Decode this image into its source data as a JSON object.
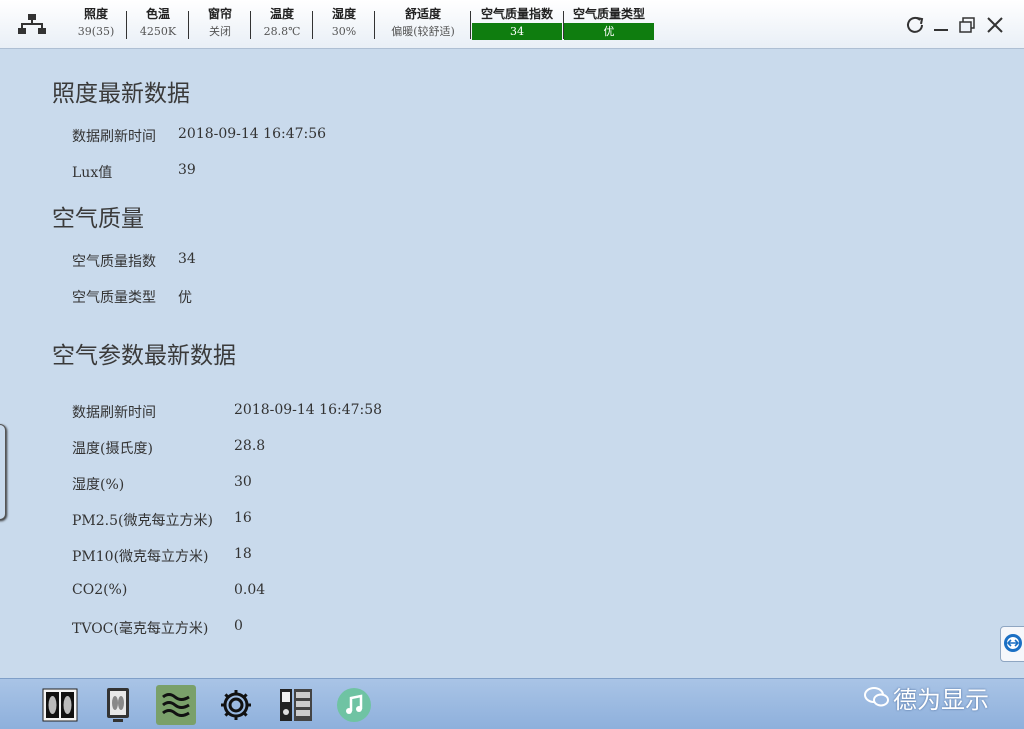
{
  "topbar": {
    "metrics": [
      {
        "label": "照度",
        "value": "39(35)"
      },
      {
        "label": "色温",
        "value": "4250K"
      },
      {
        "label": "窗帘",
        "value": "关闭"
      },
      {
        "label": "温度",
        "value": "28.8℃"
      },
      {
        "label": "湿度",
        "value": "30%"
      },
      {
        "label": "舒适度",
        "value": "偏暖(较舒适)"
      },
      {
        "label": "空气质量指数",
        "value": "34"
      },
      {
        "label": "空气质量类型",
        "value": "优"
      }
    ],
    "status_color": "#0f7d0f"
  },
  "illuminance": {
    "title": "照度最新数据",
    "refresh_label": "数据刷新时间",
    "refresh_value": "2018-09-14 16:47:56",
    "lux_label": "Lux值",
    "lux_value": "39"
  },
  "air_quality": {
    "title": "空气质量",
    "index_label": "空气质量指数",
    "index_value": "34",
    "type_label": "空气质量类型",
    "type_value": "优"
  },
  "air_params": {
    "title": "空气参数最新数据",
    "rows": [
      {
        "label": "数据刷新时间",
        "value": "2018-09-14 16:47:58"
      },
      {
        "label": "温度(摄氏度)",
        "value": "28.8"
      },
      {
        "label": "湿度(%)",
        "value": "30"
      },
      {
        "label": "PM2.5(微克每立方米)",
        "value": "16"
      },
      {
        "label": "PM10(微克每立方米)",
        "value": "18"
      },
      {
        "label": "CO2(%)",
        "value": "0.04"
      },
      {
        "label": "TVOC(毫克每立方米)",
        "value": "0"
      }
    ]
  },
  "dock": {
    "items": [
      "xray-icon",
      "monitor-icon",
      "air-waves-icon",
      "gear-icon",
      "device-icon",
      "music-icon"
    ],
    "active": "air-waves-icon"
  },
  "watermark": "德为显示"
}
